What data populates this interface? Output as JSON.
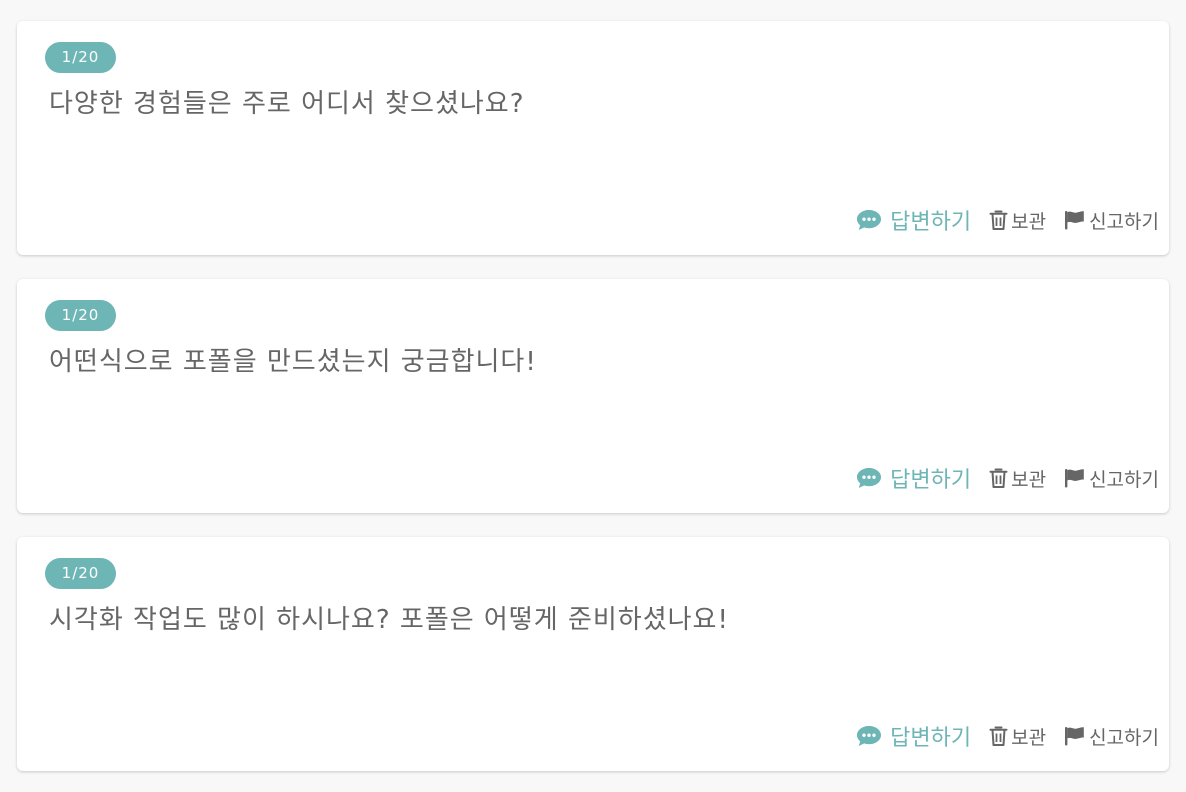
{
  "colors": {
    "accent": "#6eb5b6",
    "text": "#666666",
    "background": "#f8f8f8",
    "card": "#ffffff"
  },
  "actions": {
    "answer_label": "답변하기",
    "answer_icon": "chat-bubble-icon",
    "archive_label": "보관",
    "archive_icon": "trash-icon",
    "report_label": "신고하기",
    "report_icon": "flag-icon"
  },
  "questions": [
    {
      "badge": "1/20",
      "text": "다양한 경험들은 주로 어디서 찾으셨나요?"
    },
    {
      "badge": "1/20",
      "text": "어떤식으로 포폴을 만드셨는지 궁금합니다!"
    },
    {
      "badge": "1/20",
      "text": "시각화 작업도 많이 하시나요? 포폴은 어떻게 준비하셨나요!"
    }
  ]
}
